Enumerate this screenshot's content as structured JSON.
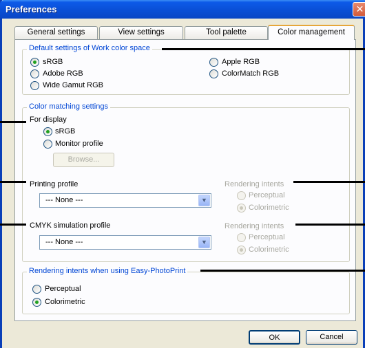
{
  "window": {
    "title": "Preferences",
    "close_glyph": "✕"
  },
  "tabs": [
    {
      "label": "General settings"
    },
    {
      "label": "View settings"
    },
    {
      "label": "Tool palette"
    },
    {
      "label": "Color management"
    }
  ],
  "work_color_space": {
    "legend": "Default settings of Work color space",
    "options": [
      {
        "label": "sRGB",
        "checked": true
      },
      {
        "label": "Apple RGB",
        "checked": false
      },
      {
        "label": "Adobe RGB",
        "checked": false
      },
      {
        "label": "ColorMatch RGB",
        "checked": false
      },
      {
        "label": "Wide Gamut RGB",
        "checked": false
      }
    ]
  },
  "color_matching": {
    "legend": "Color matching settings",
    "for_display": {
      "label": "For display",
      "options": [
        {
          "label": "sRGB",
          "checked": true
        },
        {
          "label": "Monitor profile",
          "checked": false
        }
      ],
      "browse_label": "Browse..."
    },
    "printing_profile": {
      "label": "Printing profile",
      "value": "--- None ---",
      "intents_label": "Rendering intents",
      "intents": [
        {
          "label": "Perceptual",
          "checked": false
        },
        {
          "label": "Colorimetric",
          "checked": true
        }
      ]
    },
    "cmyk_profile": {
      "label": "CMYK simulation profile",
      "value": "--- None ---",
      "intents_label": "Rendering intents",
      "intents": [
        {
          "label": "Perceptual",
          "checked": false
        },
        {
          "label": "Colorimetric",
          "checked": true
        }
      ]
    }
  },
  "easy_photoprint": {
    "legend": "Rendering intents when using Easy-PhotoPrint",
    "options": [
      {
        "label": "Perceptual",
        "checked": false
      },
      {
        "label": "Colorimetric",
        "checked": true
      }
    ]
  },
  "footer": {
    "ok_label": "OK",
    "cancel_label": "Cancel"
  },
  "icons": {
    "dropdown_arrow": "chevron-down-icon"
  },
  "colors": {
    "title_bar": "#0a4fd6",
    "accent_legend": "#0046d5",
    "active_tab_border": "#e6a63a"
  }
}
